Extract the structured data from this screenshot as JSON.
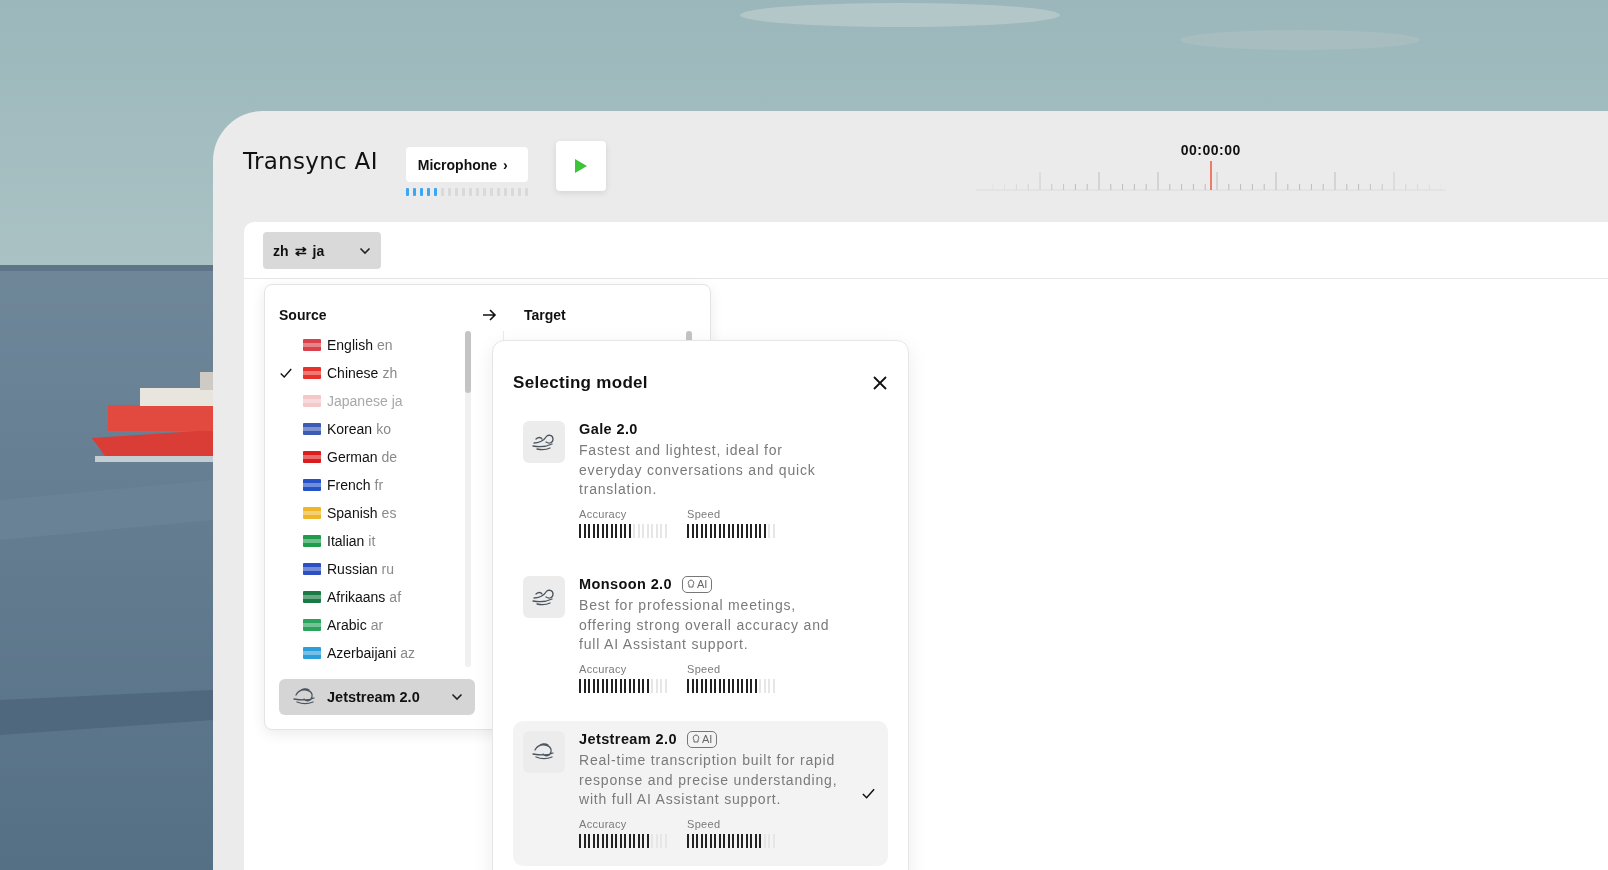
{
  "app": {
    "title": "Transync AI"
  },
  "input": {
    "label": "Microphone",
    "chevron": "›",
    "level": 0.28
  },
  "playback": {
    "playing": false
  },
  "timer": {
    "time": "00:00:00"
  },
  "language_pair": {
    "source": "zh",
    "swap": "⇄",
    "target": "ja"
  },
  "language_menu": {
    "source_heading": "Source",
    "target_heading": "Target",
    "source_languages": [
      {
        "name": "English",
        "code": "en",
        "color": "#d9424b",
        "checked": false,
        "disabled": false
      },
      {
        "name": "Chinese",
        "code": "zh",
        "color": "#e8312a",
        "checked": true,
        "disabled": false
      },
      {
        "name": "Japanese",
        "code": "ja",
        "color": "#f4c7c9",
        "checked": false,
        "disabled": true
      },
      {
        "name": "Korean",
        "code": "ko",
        "color": "#3b5bb5",
        "checked": false,
        "disabled": false
      },
      {
        "name": "German",
        "code": "de",
        "color": "#dd1d1d",
        "checked": false,
        "disabled": false
      },
      {
        "name": "French",
        "code": "fr",
        "color": "#2450c8",
        "checked": false,
        "disabled": false
      },
      {
        "name": "Spanish",
        "code": "es",
        "color": "#f0b62a",
        "checked": false,
        "disabled": false
      },
      {
        "name": "Italian",
        "code": "it",
        "color": "#1f9d4a",
        "checked": false,
        "disabled": false
      },
      {
        "name": "Russian",
        "code": "ru",
        "color": "#2c4fc4",
        "checked": false,
        "disabled": false
      },
      {
        "name": "Afrikaans",
        "code": "af",
        "color": "#1a7a43",
        "checked": false,
        "disabled": false
      },
      {
        "name": "Arabic",
        "code": "ar",
        "color": "#2aa35c",
        "checked": false,
        "disabled": false
      },
      {
        "name": "Azerbaijani",
        "code": "az",
        "color": "#2b9fd9",
        "checked": false,
        "disabled": false
      }
    ],
    "model_button": {
      "label": "Jetstream 2.0"
    }
  },
  "model_dialog": {
    "title": "Selecting model",
    "models": [
      {
        "name": "Gale 2.0",
        "ai": false,
        "description": "Fastest and lightest, ideal for everyday conversations and quick translation.",
        "selected": false,
        "accuracy": {
          "label": "Accuracy",
          "level": 0.62
        },
        "speed": {
          "label": "Speed",
          "level": 0.9
        }
      },
      {
        "name": "Monsoon 2.0",
        "ai": true,
        "badge": "AI",
        "description": "Best for professional meetings, offering strong overall accuracy and full AI Assistant support.",
        "selected": false,
        "accuracy": {
          "label": "Accuracy",
          "level": 0.8
        },
        "speed": {
          "label": "Speed",
          "level": 0.8
        }
      },
      {
        "name": "Jetstream 2.0",
        "ai": true,
        "badge": "AI",
        "description": "Real-time transcription built for rapid response and precise understanding, with full AI Assistant support.",
        "selected": true,
        "accuracy": {
          "label": "Accuracy",
          "level": 0.8
        },
        "speed": {
          "label": "Speed",
          "level": 0.85
        }
      }
    ]
  }
}
